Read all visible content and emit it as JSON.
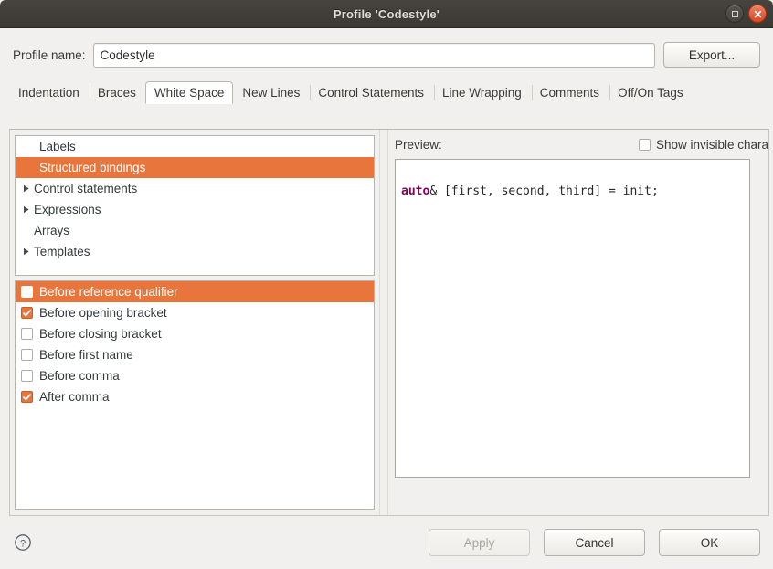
{
  "window": {
    "title": "Profile 'Codestyle'",
    "maximize_icon": "maximize-icon",
    "close_icon": "close-icon"
  },
  "profile": {
    "label": "Profile name:",
    "value": "Codestyle",
    "placeholder": "",
    "export_label": "Export..."
  },
  "tabs": [
    {
      "label": "Indentation",
      "active": false
    },
    {
      "label": "Braces",
      "active": false
    },
    {
      "label": "White Space",
      "active": true
    },
    {
      "label": "New Lines",
      "active": false
    },
    {
      "label": "Control Statements",
      "active": false
    },
    {
      "label": "Line Wrapping",
      "active": false
    },
    {
      "label": "Comments",
      "active": false
    },
    {
      "label": "Off/On Tags",
      "active": false
    }
  ],
  "tree": {
    "items": [
      {
        "label": "Labels",
        "expandable": false,
        "child": true,
        "selected": false
      },
      {
        "label": "Structured bindings",
        "expandable": false,
        "child": true,
        "selected": true
      },
      {
        "label": "Control statements",
        "expandable": true,
        "child": false,
        "selected": false
      },
      {
        "label": "Expressions",
        "expandable": true,
        "child": false,
        "selected": false
      },
      {
        "label": "Arrays",
        "expandable": false,
        "child": false,
        "selected": false
      },
      {
        "label": "Templates",
        "expandable": true,
        "child": false,
        "selected": false
      }
    ]
  },
  "options": {
    "items": [
      {
        "label": "Before reference qualifier",
        "checked": false,
        "selected": true
      },
      {
        "label": "Before opening bracket",
        "checked": true,
        "selected": false
      },
      {
        "label": "Before closing bracket",
        "checked": false,
        "selected": false
      },
      {
        "label": "Before first name",
        "checked": false,
        "selected": false
      },
      {
        "label": "Before comma",
        "checked": false,
        "selected": false
      },
      {
        "label": "After comma",
        "checked": true,
        "selected": false
      }
    ]
  },
  "preview": {
    "label": "Preview:",
    "show_invisible_label": "Show invisible chara",
    "show_invisible_checked": false,
    "code_keyword": "auto",
    "code_rest": "& [first, second, third] = init;"
  },
  "footer": {
    "help_icon": "help-icon",
    "apply_label": "Apply",
    "apply_enabled": false,
    "cancel_label": "Cancel",
    "ok_label": "OK"
  },
  "colors": {
    "accent": "#e8763c",
    "titlebar": "#3f3c37",
    "close_button": "#da4721",
    "keyword": "#7d0552",
    "background": "#f1f0ee"
  }
}
